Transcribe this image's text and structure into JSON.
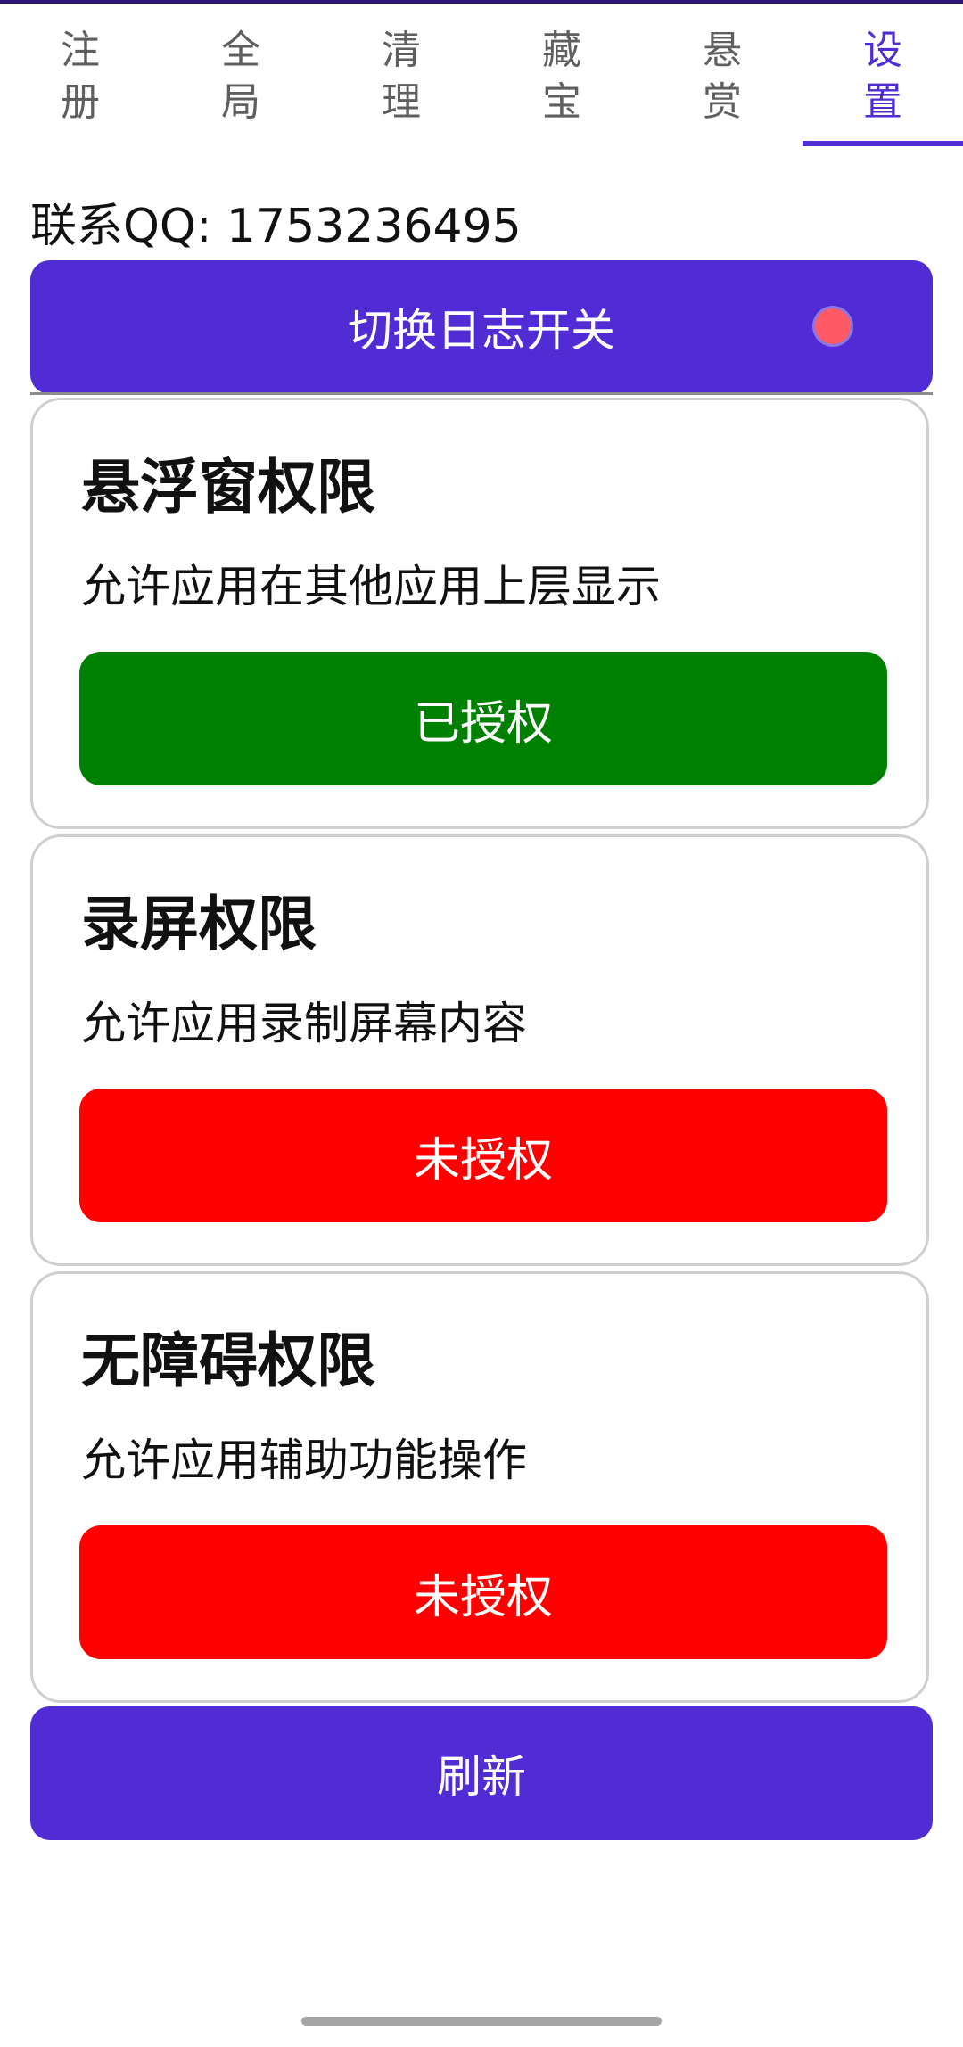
{
  "tabs": [
    {
      "label": "注册",
      "active": false
    },
    {
      "label": "全局",
      "active": false
    },
    {
      "label": "清理",
      "active": false
    },
    {
      "label": "藏宝",
      "active": false
    },
    {
      "label": "悬赏",
      "active": false
    },
    {
      "label": "设置",
      "active": true
    }
  ],
  "contact": "联系QQ: 1753236495",
  "log_toggle": {
    "label": "切换日志开关",
    "dot_color": "#ff5a66"
  },
  "permissions": [
    {
      "title": "悬浮窗权限",
      "description": "允许应用在其他应用上层显示",
      "status": "已授权",
      "status_color": "#008000"
    },
    {
      "title": "录屏权限",
      "description": "允许应用录制屏幕内容",
      "status": "未授权",
      "status_color": "#ff0000"
    },
    {
      "title": "无障碍权限",
      "description": "允许应用辅助功能操作",
      "status": "未授权",
      "status_color": "#ff0000"
    }
  ],
  "refresh_label": "刷新",
  "colors": {
    "accent": "#512bd4",
    "granted": "#008000",
    "denied": "#ff0000"
  }
}
